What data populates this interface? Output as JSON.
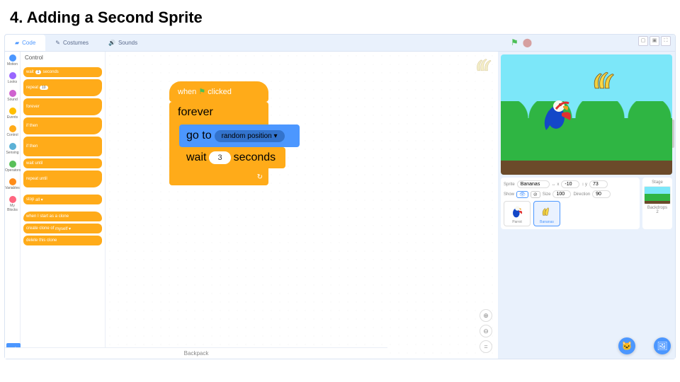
{
  "title": "4. Adding a Second Sprite",
  "tabs": {
    "code": "Code",
    "costumes": "Costumes",
    "sounds": "Sounds"
  },
  "categories": [
    {
      "name": "Motion",
      "color": "#4c97ff"
    },
    {
      "name": "Looks",
      "color": "#9966ff"
    },
    {
      "name": "Sound",
      "color": "#cf63cf"
    },
    {
      "name": "Events",
      "color": "#ffbf00"
    },
    {
      "name": "Control",
      "color": "#ffab19"
    },
    {
      "name": "Sensing",
      "color": "#5cb1d6"
    },
    {
      "name": "Operators",
      "color": "#59c059"
    },
    {
      "name": "Variables",
      "color": "#ff8c1a"
    },
    {
      "name": "My Blocks",
      "color": "#ff6680"
    }
  ],
  "palette_header": "Control",
  "palette": {
    "wait": "wait",
    "wait_val": "1",
    "wait_sec": "seconds",
    "repeat": "repeat",
    "repeat_val": "10",
    "forever": "forever",
    "if": "if",
    "then": "then",
    "wait_until": "wait until",
    "repeat_until": "repeat until",
    "stop": "stop",
    "stop_opt": "all ▾",
    "clone_start": "when I start as a clone",
    "create_clone": "create clone of",
    "create_clone_opt": "myself ▾",
    "delete_clone": "delete this clone"
  },
  "script": {
    "when_clicked": "when",
    "clicked": "clicked",
    "forever": "forever",
    "goto": "go to",
    "goto_opt": "random position ▾",
    "wait": "wait",
    "wait_val": "3",
    "seconds": "seconds"
  },
  "sprite_info": {
    "sprite_lbl": "Sprite",
    "sprite_name": "Bananas",
    "x_lbl": "x",
    "x_val": "-10",
    "y_lbl": "y",
    "y_val": "73",
    "show_lbl": "Show",
    "size_lbl": "Size",
    "size_val": "100",
    "dir_lbl": "Direction",
    "dir_val": "90"
  },
  "thumbs": {
    "parrot": "Parrot",
    "bananas": "Bananas"
  },
  "stage": {
    "label": "Stage",
    "backdrops": "Backdrops",
    "count": "2"
  },
  "backpack": "Backpack",
  "xy_icon": "↔ x",
  "y_icon": "↕ y"
}
